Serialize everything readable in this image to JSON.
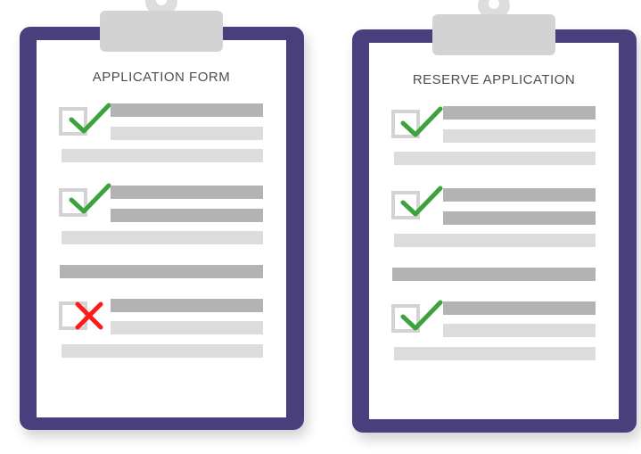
{
  "forms": [
    {
      "title": "APPLICATION FORM",
      "items": [
        {
          "status": "checked",
          "icon": "check-icon"
        },
        {
          "status": "checked",
          "icon": "check-icon"
        },
        {
          "status": "rejected",
          "icon": "cross-icon"
        }
      ]
    },
    {
      "title": "RESERVE APPLICATION",
      "items": [
        {
          "status": "checked",
          "icon": "check-icon"
        },
        {
          "status": "checked",
          "icon": "check-icon"
        },
        {
          "status": "checked",
          "icon": "check-icon"
        }
      ]
    }
  ],
  "colors": {
    "board": "#4a3f7d",
    "check": "#3ca23c",
    "cross": "#ff1a1a",
    "bar_dark": "#b3b3b3",
    "bar_light": "#dcdcdc",
    "clip": "#d3d3d3"
  }
}
